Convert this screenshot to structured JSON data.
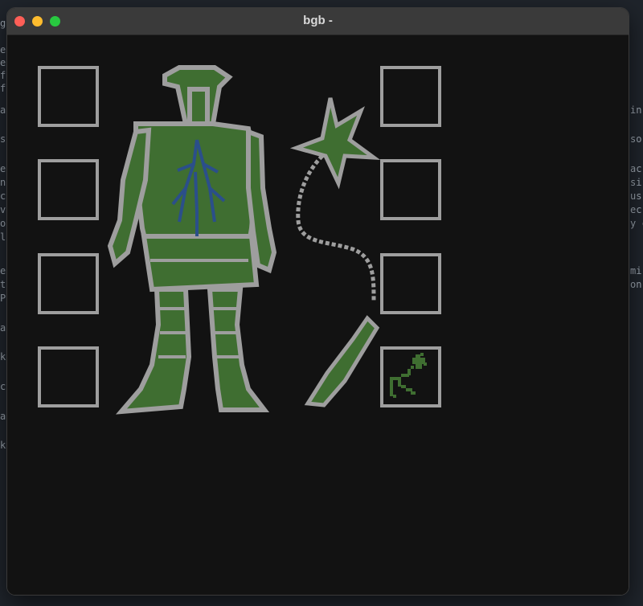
{
  "window": {
    "title": "bgb -"
  },
  "background_terminal": {
    "left_fragments": [
      "g",
      "er",
      "er",
      "ff",
      "ff",
      "a",
      "",
      "",
      "s",
      "",
      "",
      "e",
      "nt",
      "cc",
      "ve",
      "ou",
      "lo",
      "",
      "",
      "e",
      "t",
      "Pr",
      "",
      "",
      "ar",
      "",
      "",
      "ke",
      "",
      "",
      "ca",
      "",
      "",
      "ar",
      "",
      "",
      "ke"
    ],
    "right_fragments": [
      "in",
      "so",
      "ac",
      "si",
      "us",
      "ec",
      "y c",
      "mi",
      "on"
    ]
  },
  "equipment": {
    "left_slots": [
      "empty",
      "empty",
      "empty",
      "empty"
    ],
    "right_slots": [
      "empty",
      "empty",
      "empty",
      "whip"
    ]
  },
  "colors": {
    "armor_green": "#3f6e31",
    "armor_outline": "#9e9e9e",
    "body_blue": "#2b4f8a",
    "slot_border": "#9e9e9e",
    "background": "#121212"
  }
}
